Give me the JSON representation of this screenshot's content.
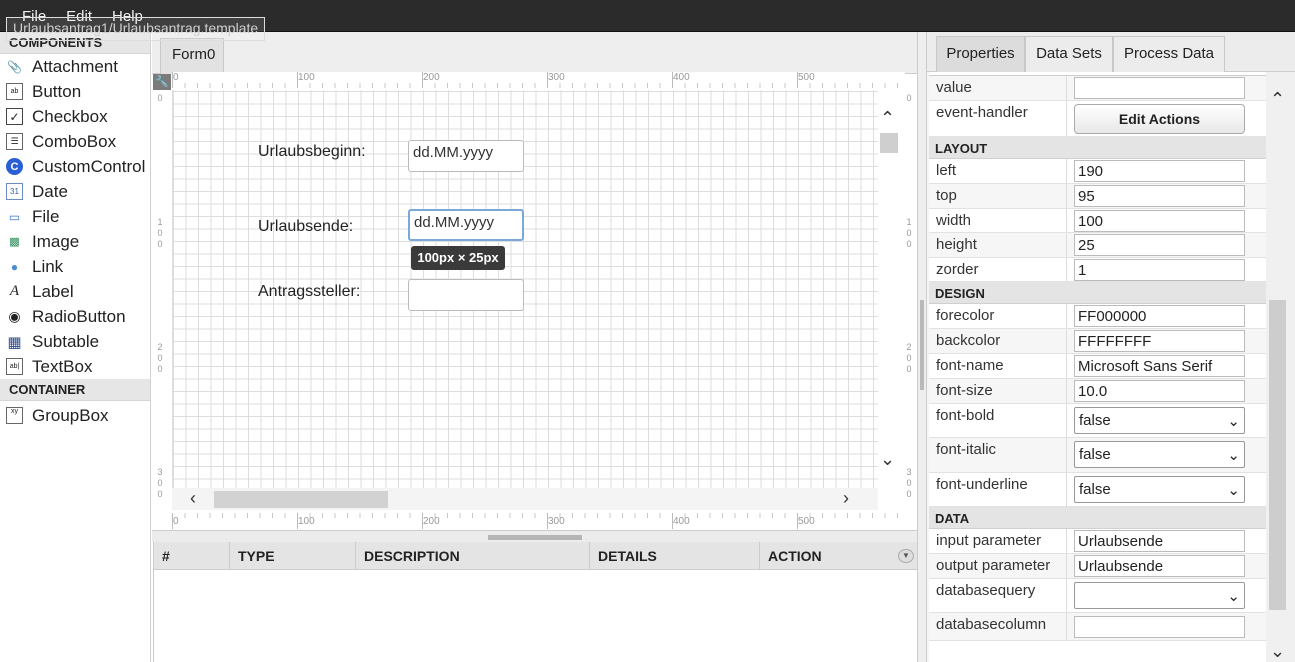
{
  "menu": {
    "file": "File",
    "edit": "Edit",
    "help": "Help"
  },
  "document_title": "Urlaubsantrag1/Urlaubsantrag.template",
  "components": {
    "header": "COMPONENTS",
    "items": [
      {
        "label": "Attachment",
        "icon": "paperclip-icon"
      },
      {
        "label": "Button",
        "icon": "button-icon"
      },
      {
        "label": "Checkbox",
        "icon": "checkbox-icon"
      },
      {
        "label": "ComboBox",
        "icon": "combobox-icon"
      },
      {
        "label": "CustomControl",
        "icon": "custom-control-icon"
      },
      {
        "label": "Date",
        "icon": "calendar-icon"
      },
      {
        "label": "File",
        "icon": "file-icon"
      },
      {
        "label": "Image",
        "icon": "image-icon"
      },
      {
        "label": "Link",
        "icon": "globe-icon"
      },
      {
        "label": "Label",
        "icon": "label-icon"
      },
      {
        "label": "RadioButton",
        "icon": "radio-icon"
      },
      {
        "label": "Subtable",
        "icon": "table-icon"
      },
      {
        "label": "TextBox",
        "icon": "textbox-icon"
      }
    ],
    "container_header": "CONTAINER",
    "container_items": [
      {
        "label": "GroupBox",
        "icon": "groupbox-icon"
      }
    ]
  },
  "canvas": {
    "tab": "Form0",
    "ruler_labels": [
      "0",
      "100",
      "200",
      "300",
      "400",
      "500"
    ],
    "vruler_labels": [
      [
        "0"
      ],
      [
        "1",
        "0",
        "0"
      ],
      [
        "2",
        "0",
        "0"
      ],
      [
        "3",
        "0",
        "0"
      ]
    ],
    "fields": [
      {
        "label": "Urlaubsbeginn:",
        "value": "dd.MM.yyyy"
      },
      {
        "label": "Urlaubsende:",
        "value": "dd.MM.yyyy"
      },
      {
        "label": "Antragssteller:",
        "value": ""
      }
    ],
    "size_tooltip": "100px × 25px"
  },
  "messages": {
    "columns": [
      "#",
      "TYPE",
      "DESCRIPTION",
      "DETAILS",
      "ACTION"
    ]
  },
  "right_panel": {
    "tabs": [
      "Properties",
      "Data Sets",
      "Process Data"
    ],
    "top_rows": [
      {
        "name": "value",
        "value": ""
      },
      {
        "name": "event-handler",
        "button": "Edit Actions"
      }
    ],
    "layout_header": "LAYOUT",
    "layout": [
      {
        "name": "left",
        "value": "190"
      },
      {
        "name": "top",
        "value": "95"
      },
      {
        "name": "width",
        "value": "100"
      },
      {
        "name": "height",
        "value": "25"
      },
      {
        "name": "zorder",
        "value": "1"
      }
    ],
    "design_header": "DESIGN",
    "design": [
      {
        "name": "forecolor",
        "value": "FF000000"
      },
      {
        "name": "backcolor",
        "value": "FFFFFFFF"
      },
      {
        "name": "font-name",
        "value": "Microsoft Sans Serif"
      },
      {
        "name": "font-size",
        "value": "10.0"
      }
    ],
    "design_selects": [
      {
        "name": "font-bold",
        "value": "false"
      },
      {
        "name": "font-italic",
        "value": "false"
      },
      {
        "name": "font-underline",
        "value": "false"
      }
    ],
    "data_header": "DATA",
    "data": [
      {
        "name": "input parameter",
        "value": "Urlaubsende"
      },
      {
        "name": "output parameter",
        "value": "Urlaubsende"
      }
    ],
    "databasequery": {
      "name": "databasequery",
      "value": ""
    },
    "databasecolumn": {
      "name": "databasecolumn",
      "value": ""
    }
  },
  "colors": {
    "topbar": "#2b2b2b",
    "selection": "#7aa8d8",
    "tooltip": "#3a3a3a"
  }
}
